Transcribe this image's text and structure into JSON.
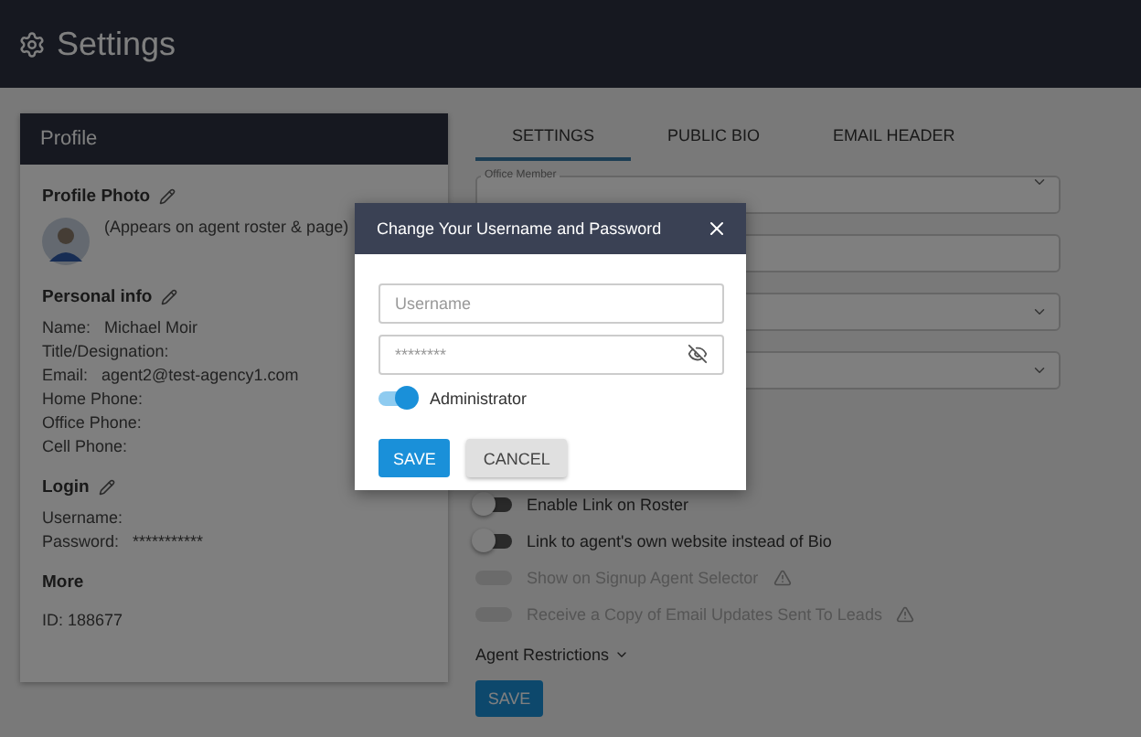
{
  "header": {
    "title": "Settings"
  },
  "profile": {
    "title": "Profile",
    "photo_heading": "Profile Photo",
    "photo_note": "(Appears on agent roster & page)",
    "personal_heading": "Personal info",
    "personal": [
      {
        "label": "Name:",
        "value": "Michael Moir"
      },
      {
        "label": "Title/Designation:"
      },
      {
        "label": "Email:",
        "value": "agent2@test-agency1.com"
      },
      {
        "label": "Home Phone:"
      },
      {
        "label": "Office Phone:"
      },
      {
        "label": "Cell Phone:"
      }
    ],
    "login_heading": "Login",
    "login": [
      {
        "label": "Username:"
      },
      {
        "label": "Password:",
        "value": "***********"
      }
    ],
    "more_heading": "More",
    "id": "ID: 188677"
  },
  "tabs": [
    {
      "label": "SETTINGS",
      "selected": true
    },
    {
      "label": "PUBLIC BIO",
      "selected": false
    },
    {
      "label": "EMAIL HEADER",
      "selected": false
    }
  ],
  "fields": [
    {
      "kind": "select",
      "label": "Office Member"
    },
    {
      "kind": "text"
    },
    {
      "kind": "select"
    },
    {
      "kind": "select"
    }
  ],
  "toggles": [
    {
      "label": "Enable Link on Roster",
      "on": false,
      "disabled": false,
      "warning": false
    },
    {
      "label": "Link to agent's own website instead of Bio",
      "on": false,
      "disabled": false,
      "warning": false
    },
    {
      "label": "Show on Signup Agent Selector",
      "on": false,
      "disabled": true,
      "warning": true
    },
    {
      "label": "Receive a Copy of Email Updates Sent To Leads",
      "on": false,
      "disabled": true,
      "warning": true
    }
  ],
  "restrictions": "Agent Restrictions",
  "save": "SAVE",
  "dialog": {
    "title": "Change Your Username and Password",
    "username_placeholder": "Username",
    "password_placeholder": "********",
    "admin": {
      "label": "Administrator",
      "on": true
    },
    "save": "SAVE",
    "cancel": "CANCEL"
  }
}
